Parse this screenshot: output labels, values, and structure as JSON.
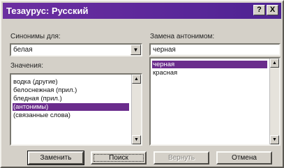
{
  "window": {
    "title": "Тезаурус: Русский"
  },
  "title_buttons": {
    "help": "?",
    "close": "X"
  },
  "synonyms": {
    "label": "Синонимы для:",
    "value": "белая",
    "meanings_label": "Значения:",
    "meanings": [
      {
        "text": "водка (другие)",
        "selected": false
      },
      {
        "text": "белоснежная (прил.)",
        "selected": false
      },
      {
        "text": "бледная (прил.)",
        "selected": false
      },
      {
        "text": "(антонимы)",
        "selected": true
      },
      {
        "text": "(связанные слова)",
        "selected": false
      }
    ]
  },
  "replace": {
    "label": "Замена антонимом:",
    "value": "черная",
    "items": [
      {
        "text": "черная",
        "selected": true
      },
      {
        "text": "красная",
        "selected": false
      }
    ]
  },
  "buttons": {
    "replace": "Заменить",
    "search": "Поиск",
    "previous": "Вернуть",
    "cancel": "Отмена"
  },
  "icons": {
    "dropdown": "chevron-down-icon",
    "scroll_up": "scroll-up-arrow-icon",
    "scroll_down": "scroll-down-arrow-icon"
  },
  "colors": {
    "title_bar": "#5b279a",
    "selection": "#6a2c8c",
    "dialog_face": "#d4d0c8"
  }
}
